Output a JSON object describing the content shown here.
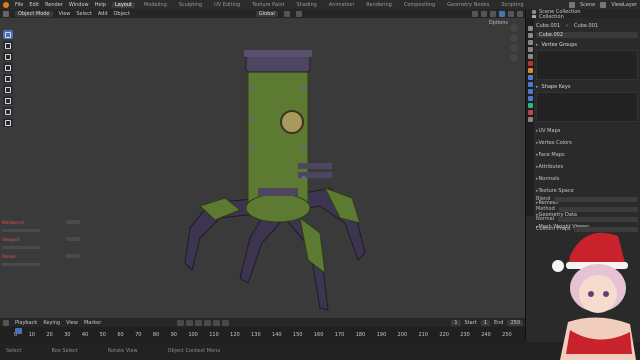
{
  "topbar": {
    "menus": [
      "File",
      "Edit",
      "Render",
      "Window",
      "Help"
    ],
    "tabs": [
      "Layout",
      "Modeling",
      "Sculpting",
      "UV Editing",
      "Texture Paint",
      "Shading",
      "Animation",
      "Rendering",
      "Compositing",
      "Geometry Nodes",
      "Scripting"
    ],
    "active_tab": "Layout",
    "scene": "Scene",
    "view_layer": "ViewLayer"
  },
  "viewport_header": {
    "mode": "Object Mode",
    "view": "View",
    "select": "Select",
    "add": "Add",
    "object": "Object",
    "orientation": "Global",
    "options": "Options"
  },
  "left_panel": {
    "rows": [
      "Workbench",
      "Viewport",
      "Render"
    ]
  },
  "timeline_header": {
    "playback": "Playback",
    "keying": "Keying",
    "view": "View",
    "marker": "Marker",
    "current_frame": "1",
    "start_label": "Start",
    "start": "1",
    "end_label": "End",
    "end": "250"
  },
  "timeline_ticks": [
    "0",
    "10",
    "20",
    "30",
    "40",
    "50",
    "60",
    "70",
    "80",
    "90",
    "100",
    "110",
    "120",
    "130",
    "140",
    "150",
    "160",
    "170",
    "180",
    "190",
    "200",
    "210",
    "220",
    "230",
    "240",
    "250"
  ],
  "status": {
    "select": "Select",
    "box_select": "Box Select",
    "rotate": "Rotate View",
    "context": "Object Context Menu"
  },
  "outliner": {
    "title": "Scene Collection",
    "collection": "Collection"
  },
  "properties": {
    "breadcrumb_object": "Cube.001",
    "breadcrumb_data": "Cube.001",
    "data_name": "Cube.002",
    "sections": [
      "Vertex Groups",
      "Shape Keys"
    ],
    "collapsed": [
      "UV Maps",
      "Vertex Colors",
      "Face Maps",
      "Attributes",
      "Normals",
      "Texture Space",
      "Remesh",
      "Geometry Data",
      "Mesh Weight Viewer"
    ],
    "footer": [
      "Blend",
      "Method",
      "Normal",
      "Custom Props"
    ]
  },
  "colors": {
    "accent": "#4772b3",
    "robot_body": "#5d7a33",
    "robot_metal": "#4e4560",
    "overlay_hat": "#c8232c",
    "overlay_hair": "#e6c2d4"
  }
}
